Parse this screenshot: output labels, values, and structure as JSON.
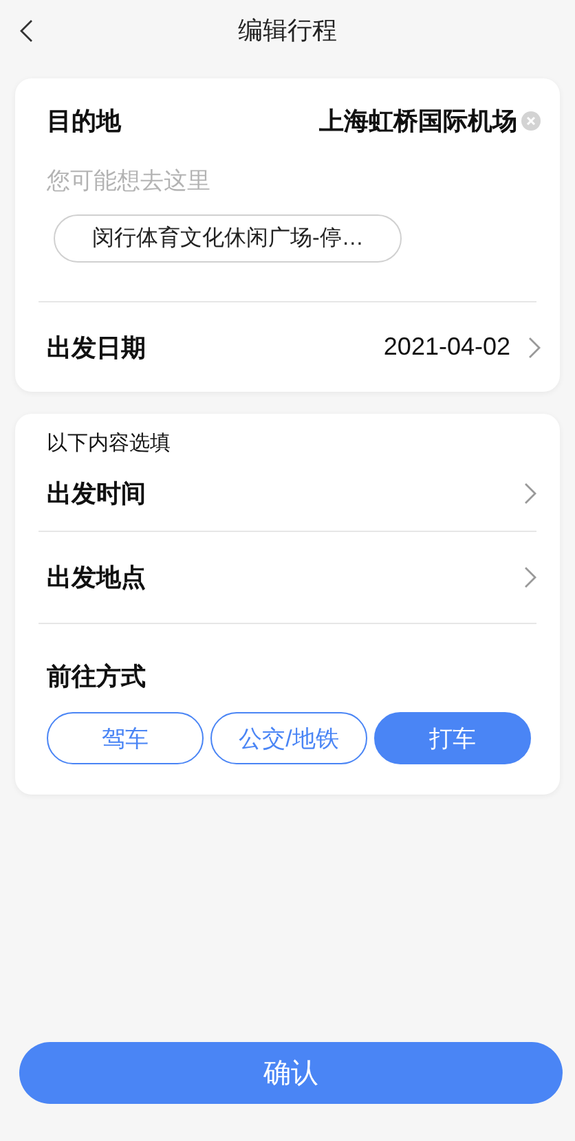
{
  "header": {
    "title": "编辑行程"
  },
  "destination": {
    "label": "目的地",
    "value": "上海虹桥国际机场"
  },
  "suggestions": {
    "label": "您可能想去这里",
    "items": [
      "闵行体育文化休闲广场-停…"
    ]
  },
  "date": {
    "label": "出发日期",
    "value": "2021-04-02"
  },
  "optional": {
    "heading": "以下内容选填",
    "rows": [
      {
        "label": "出发时间"
      },
      {
        "label": "出发地点"
      }
    ],
    "transport": {
      "label": "前往方式",
      "options": [
        {
          "label": "驾车",
          "selected": false
        },
        {
          "label": "公交/地铁",
          "selected": false
        },
        {
          "label": "打车",
          "selected": true
        }
      ]
    }
  },
  "confirm": {
    "label": "确认"
  }
}
